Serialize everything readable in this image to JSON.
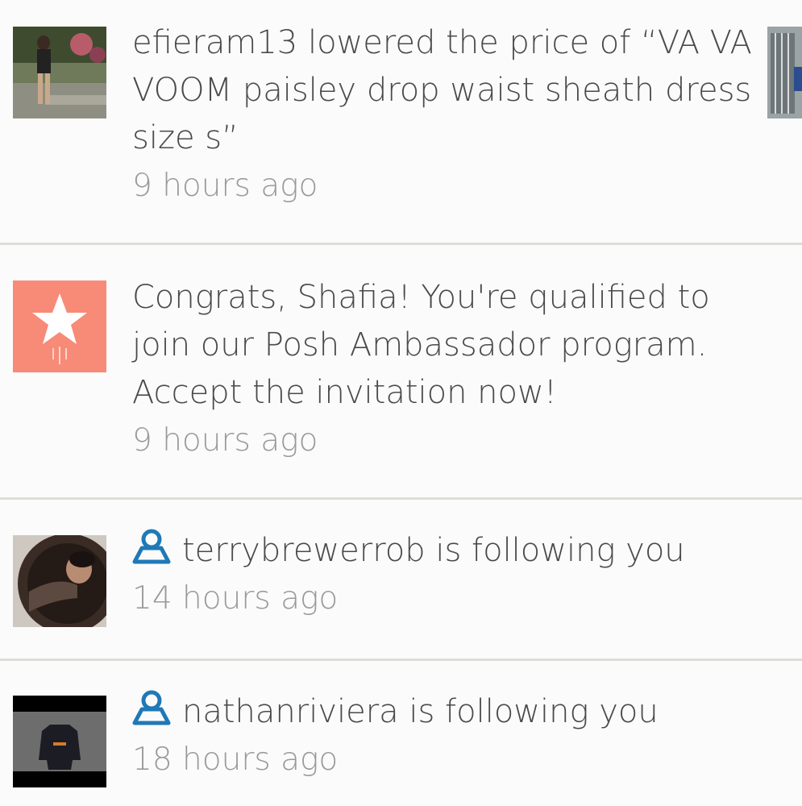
{
  "notifications": [
    {
      "text": "efieram13 lowered the price of “VA VA VOOM paisley drop waist sheath dress size s”",
      "time": "9 hours ago",
      "avatar_icon": "user-photo-outdoor",
      "listing_icon": "listing-photo"
    },
    {
      "text": "Congrats, Shafia! You're qualified to join our Posh Ambassador program. Accept the invitation now!",
      "time": "9 hours ago",
      "avatar_icon": "star-icon",
      "accent": "#f88a78"
    },
    {
      "username": "terrybrewerrob",
      "action": " is following you",
      "time": "14 hours ago",
      "avatar_icon": "user-photo-mirror",
      "status_icon": "follow-person-icon"
    },
    {
      "username": "nathanriviera",
      "action": " is following you",
      "time": "18 hours ago",
      "avatar_icon": "user-photo-sweatshirt",
      "status_icon": "follow-person-icon"
    }
  ],
  "colors": {
    "follow_icon": "#1f79b6",
    "text": "#4a4a4a",
    "time": "#9a9a9a",
    "divider": "#dcdcd8"
  }
}
